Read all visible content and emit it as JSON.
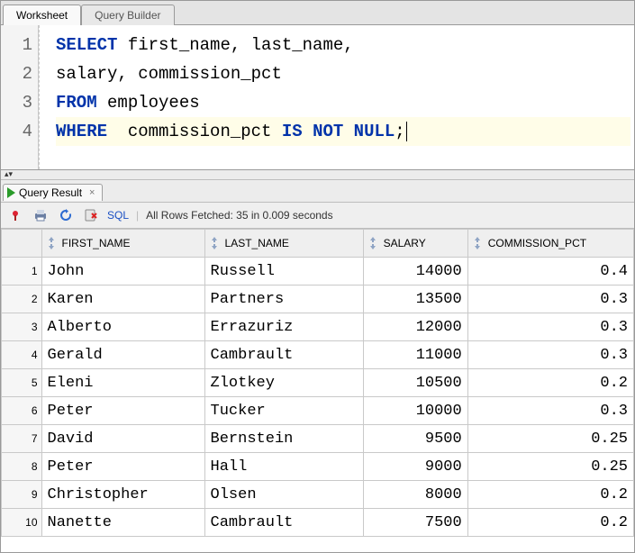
{
  "tabs": {
    "worksheet": "Worksheet",
    "query_builder": "Query Builder"
  },
  "editor": {
    "lines": [
      {
        "n": "1",
        "tokens": [
          {
            "t": "SELECT ",
            "c": "kw"
          },
          {
            "t": "first_name, last_name,"
          }
        ]
      },
      {
        "n": "2",
        "tokens": [
          {
            "t": "salary, commission_pct"
          }
        ]
      },
      {
        "n": "3",
        "tokens": [
          {
            "t": "FROM ",
            "c": "kw"
          },
          {
            "t": "employees"
          }
        ]
      },
      {
        "n": "4",
        "tokens": [
          {
            "t": "WHERE ",
            "c": "kw"
          },
          {
            "t": " commission_pct "
          },
          {
            "t": "IS NOT NULL",
            "c": "kw"
          },
          {
            "t": ";"
          }
        ],
        "current": true,
        "caret": true
      }
    ]
  },
  "result_tab": {
    "label": "Query Result"
  },
  "toolbar": {
    "sql_label": "SQL",
    "status": "All Rows Fetched: 35 in 0.009 seconds"
  },
  "grid": {
    "columns": [
      "FIRST_NAME",
      "LAST_NAME",
      "SALARY",
      "COMMISSION_PCT"
    ],
    "col_align": [
      "txt",
      "txt",
      "num",
      "num"
    ],
    "col_class": [
      "col-first",
      "col-last",
      "col-sal",
      "col-comm"
    ],
    "rows": [
      {
        "n": "1",
        "c": [
          "John",
          "Russell",
          "14000",
          "0.4"
        ]
      },
      {
        "n": "2",
        "c": [
          "Karen",
          "Partners",
          "13500",
          "0.3"
        ]
      },
      {
        "n": "3",
        "c": [
          "Alberto",
          "Errazuriz",
          "12000",
          "0.3"
        ]
      },
      {
        "n": "4",
        "c": [
          "Gerald",
          "Cambrault",
          "11000",
          "0.3"
        ]
      },
      {
        "n": "5",
        "c": [
          "Eleni",
          "Zlotkey",
          "10500",
          "0.2"
        ]
      },
      {
        "n": "6",
        "c": [
          "Peter",
          "Tucker",
          "10000",
          "0.3"
        ]
      },
      {
        "n": "7",
        "c": [
          "David",
          "Bernstein",
          "9500",
          "0.25"
        ]
      },
      {
        "n": "8",
        "c": [
          "Peter",
          "Hall",
          "9000",
          "0.25"
        ]
      },
      {
        "n": "9",
        "c": [
          "Christopher",
          "Olsen",
          "8000",
          "0.2"
        ]
      },
      {
        "n": "10",
        "c": [
          "Nanette",
          "Cambrault",
          "7500",
          "0.2"
        ]
      }
    ]
  }
}
